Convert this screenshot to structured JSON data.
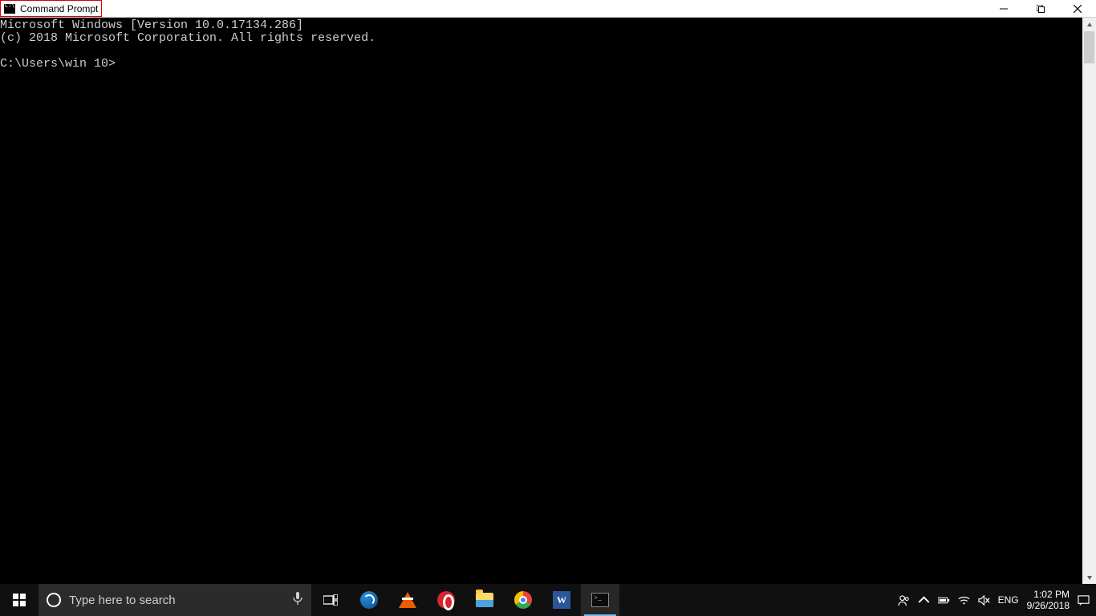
{
  "window": {
    "title": "Command Prompt"
  },
  "console": {
    "line1": "Microsoft Windows [Version 10.0.17134.286]",
    "line2": "(c) 2018 Microsoft Corporation. All rights reserved.",
    "blank": "",
    "prompt": "C:\\Users\\win 10>"
  },
  "taskbar": {
    "search_placeholder": "Type here to search",
    "language": "ENG",
    "time": "1:02 PM",
    "date": "9/26/2018",
    "word_glyph": "W"
  }
}
